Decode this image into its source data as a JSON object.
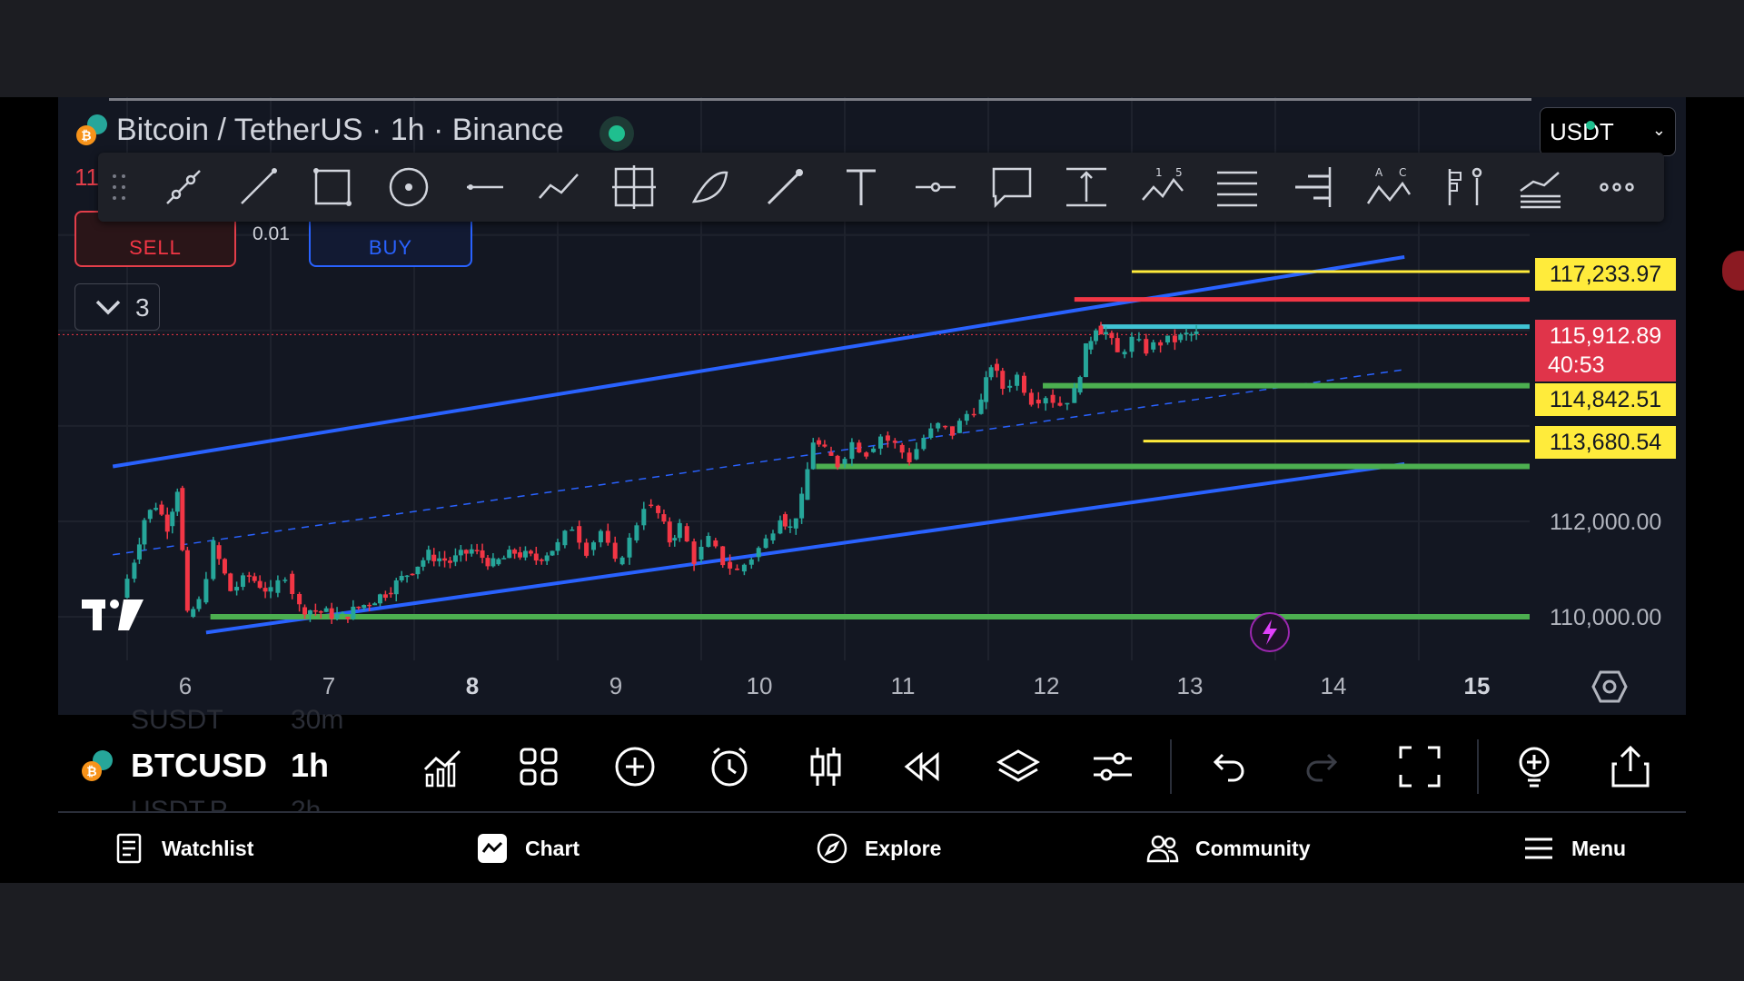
{
  "header": {
    "title": "Bitcoin / TetherUS · 1h · Binance",
    "ohlc_fragment": "11",
    "currency": "USDT"
  },
  "trade": {
    "sell_label": "SELL",
    "buy_label": "BUY",
    "quantity": "0.01",
    "indicator_count": "3"
  },
  "price_labels": {
    "current_price": "115,912.89",
    "countdown": "40:53",
    "line_117": "117,233.97",
    "line_114": "114,842.51",
    "line_113": "113,680.54"
  },
  "price_axis": [
    "112,000.00",
    "110,000.00"
  ],
  "time_axis": [
    {
      "label": "6",
      "bold": false
    },
    {
      "label": "7",
      "bold": false
    },
    {
      "label": "8",
      "bold": true
    },
    {
      "label": "9",
      "bold": false
    },
    {
      "label": "10",
      "bold": false
    },
    {
      "label": "11",
      "bold": false
    },
    {
      "label": "12",
      "bold": false
    },
    {
      "label": "13",
      "bold": false
    },
    {
      "label": "14",
      "bold": false
    },
    {
      "label": "15",
      "bold": true
    }
  ],
  "bottom_toolbar": {
    "symbol": "BTCUSD",
    "interval": "1h",
    "ghost_above_symbol": "SUSDT",
    "ghost_above_interval": "30m",
    "ghost_below_symbol": "USDT.P",
    "ghost_below_interval": "2h"
  },
  "nav": [
    {
      "label": "Watchlist",
      "icon": "watchlist-icon"
    },
    {
      "label": "Chart",
      "icon": "chart-icon"
    },
    {
      "label": "Explore",
      "icon": "compass-icon"
    },
    {
      "label": "Community",
      "icon": "community-icon"
    },
    {
      "label": "Menu",
      "icon": "menu-icon"
    }
  ],
  "colors": {
    "background": "#131722",
    "up_candle": "#26a69a",
    "down_candle": "#f23645",
    "channel": "#2962ff",
    "support": "#4caf50",
    "resistance": "#f23645",
    "level": "#ffeb3b",
    "current_level": "#40c4d4"
  },
  "chart_data": {
    "type": "candlestick",
    "symbol": "BTCUSDT",
    "interval": "1h",
    "exchange": "Binance",
    "x_range": [
      5.9,
      15.0
    ],
    "y_range": [
      109600,
      118400
    ],
    "close_points": [
      [
        5.95,
        110400
      ],
      [
        6.05,
        111200
      ],
      [
        6.12,
        112050
      ],
      [
        6.2,
        112350
      ],
      [
        6.28,
        111900
      ],
      [
        6.35,
        112700
      ],
      [
        6.42,
        110000
      ],
      [
        6.5,
        110300
      ],
      [
        6.6,
        111500
      ],
      [
        6.72,
        110550
      ],
      [
        6.85,
        110850
      ],
      [
        7.0,
        110500
      ],
      [
        7.1,
        110900
      ],
      [
        7.2,
        110200
      ],
      [
        7.35,
        110100
      ],
      [
        7.5,
        110000
      ],
      [
        7.65,
        110250
      ],
      [
        7.8,
        110500
      ],
      [
        7.95,
        110900
      ],
      [
        8.1,
        111300
      ],
      [
        8.25,
        111150
      ],
      [
        8.4,
        111400
      ],
      [
        8.55,
        111100
      ],
      [
        8.7,
        111350
      ],
      [
        8.85,
        111200
      ],
      [
        9.0,
        111500
      ],
      [
        9.1,
        111900
      ],
      [
        9.2,
        111400
      ],
      [
        9.3,
        111800
      ],
      [
        9.4,
        111100
      ],
      [
        9.5,
        111600
      ],
      [
        9.6,
        112350
      ],
      [
        9.7,
        112150
      ],
      [
        9.78,
        111600
      ],
      [
        9.85,
        111900
      ],
      [
        9.95,
        111200
      ],
      [
        10.05,
        111600
      ],
      [
        10.15,
        111150
      ],
      [
        10.25,
        110950
      ],
      [
        10.35,
        111250
      ],
      [
        10.45,
        111600
      ],
      [
        10.55,
        112150
      ],
      [
        10.62,
        111850
      ],
      [
        10.7,
        112450
      ],
      [
        10.78,
        113700
      ],
      [
        10.86,
        113450
      ],
      [
        10.95,
        113200
      ],
      [
        11.05,
        113650
      ],
      [
        11.15,
        113450
      ],
      [
        11.25,
        113800
      ],
      [
        11.35,
        113600
      ],
      [
        11.45,
        113300
      ],
      [
        11.55,
        113750
      ],
      [
        11.65,
        114000
      ],
      [
        11.75,
        113850
      ],
      [
        11.85,
        114250
      ],
      [
        11.95,
        114500
      ],
      [
        12.02,
        115300
      ],
      [
        12.1,
        114800
      ],
      [
        12.2,
        115050
      ],
      [
        12.3,
        114550
      ],
      [
        12.4,
        114650
      ],
      [
        12.5,
        114450
      ],
      [
        12.6,
        114700
      ],
      [
        12.68,
        115600
      ],
      [
        12.75,
        116100
      ],
      [
        12.82,
        115950
      ],
      [
        12.9,
        115500
      ],
      [
        13.0,
        115800
      ],
      [
        13.1,
        115600
      ],
      [
        13.2,
        115750
      ],
      [
        13.3,
        115800
      ],
      [
        13.38,
        115900
      ],
      [
        13.45,
        115913
      ]
    ],
    "channel": {
      "upper": [
        [
          5.9,
          113150
        ],
        [
          14.9,
          117540
        ]
      ],
      "lower": [
        [
          6.55,
          109670
        ],
        [
          14.9,
          113200
        ]
      ],
      "mid": [
        [
          5.9,
          111300
        ],
        [
          14.9,
          115180
        ]
      ]
    },
    "horizontal_levels": [
      {
        "price": 117233.97,
        "color": "yellow",
        "from_x": 13.0
      },
      {
        "price": 116650,
        "color": "red",
        "from_x": 12.6
      },
      {
        "price": 116080,
        "color": "cyan",
        "from_x": 12.78
      },
      {
        "price": 114842.51,
        "color": "green",
        "from_x": 12.38
      },
      {
        "price": 113680.54,
        "color": "yellow",
        "from_x": 13.08
      },
      {
        "price": 113150,
        "color": "green",
        "from_x": 10.8
      },
      {
        "price": 110000,
        "color": "green",
        "from_x": 6.58
      }
    ],
    "current_price": 115912.89,
    "y_tick_labels": [
      "112,000.00",
      "110,000.00"
    ],
    "x_tick_labels": [
      "6",
      "7",
      "8",
      "9",
      "10",
      "11",
      "12",
      "13",
      "14",
      "15"
    ]
  }
}
